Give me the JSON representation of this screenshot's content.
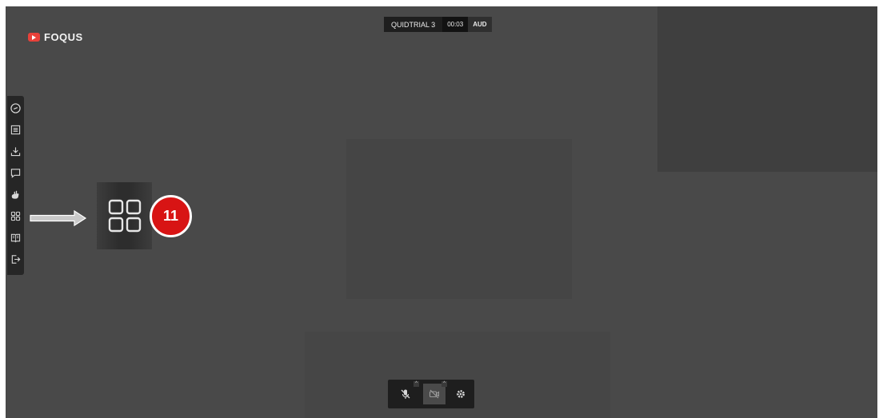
{
  "brand": {
    "name": "FOQUS",
    "accent": "#e8413a"
  },
  "header": {
    "meeting_name": "QUIDTRIAL 3",
    "timer": "00:03",
    "audio_label": "AUD"
  },
  "sidebar": {
    "items": [
      {
        "name": "link",
        "icon": "link-icon"
      },
      {
        "name": "list",
        "icon": "list-icon"
      },
      {
        "name": "download",
        "icon": "download-icon"
      },
      {
        "name": "chat",
        "icon": "chat-icon"
      },
      {
        "name": "reactions",
        "icon": "hand-icon"
      },
      {
        "name": "layout",
        "icon": "grid-layout-icon"
      },
      {
        "name": "book",
        "icon": "book-icon"
      },
      {
        "name": "exit",
        "icon": "exit-icon"
      }
    ]
  },
  "callout": {
    "icon": "grid-layout-icon",
    "number": "11",
    "badge_color": "#d81414"
  },
  "controls": [
    {
      "name": "mic",
      "icon": "mic-off-icon"
    },
    {
      "name": "camera",
      "icon": "camera-off-icon"
    },
    {
      "name": "settings",
      "icon": "gear-icon"
    }
  ]
}
